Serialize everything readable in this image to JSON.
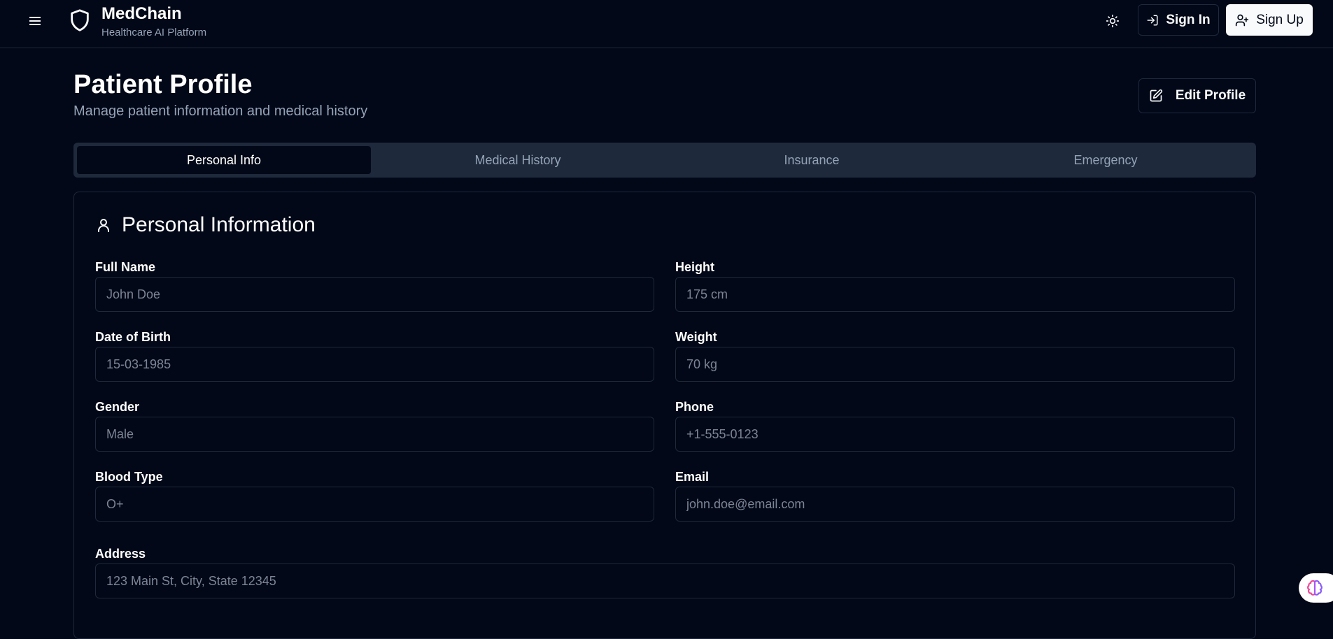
{
  "header": {
    "brand_name": "MedChain",
    "brand_tagline": "Healthcare AI Platform",
    "signin_label": "Sign In",
    "signup_label": "Sign Up",
    "icons": [
      "menu-icon",
      "shield-icon",
      "sun-icon",
      "log-in-icon",
      "user-plus-icon"
    ]
  },
  "page": {
    "title": "Patient Profile",
    "subtitle": "Manage patient information and medical history",
    "edit_label": "Edit Profile"
  },
  "tabs": [
    {
      "label": "Personal Info",
      "active": true
    },
    {
      "label": "Medical History",
      "active": false
    },
    {
      "label": "Insurance",
      "active": false
    },
    {
      "label": "Emergency",
      "active": false
    }
  ],
  "card": {
    "title": "Personal Information",
    "fields": {
      "full_name": {
        "label": "Full Name",
        "placeholder": "John Doe"
      },
      "height": {
        "label": "Height",
        "placeholder": "175 cm"
      },
      "dob": {
        "label": "Date of Birth",
        "placeholder": "15-03-1985"
      },
      "weight": {
        "label": "Weight",
        "placeholder": "70 kg"
      },
      "gender": {
        "label": "Gender",
        "placeholder": "Male"
      },
      "phone": {
        "label": "Phone",
        "placeholder": "+1-555-0123"
      },
      "blood_type": {
        "label": "Blood Type",
        "placeholder": "O+"
      },
      "email": {
        "label": "Email",
        "placeholder": "john.doe@email.com"
      },
      "address": {
        "label": "Address",
        "placeholder": "123 Main St, City, State 12345"
      }
    }
  },
  "colors": {
    "background": "#020817",
    "border": "#1e293b",
    "muted_text": "#94a3b8",
    "primary_text": "#f8fafc"
  }
}
